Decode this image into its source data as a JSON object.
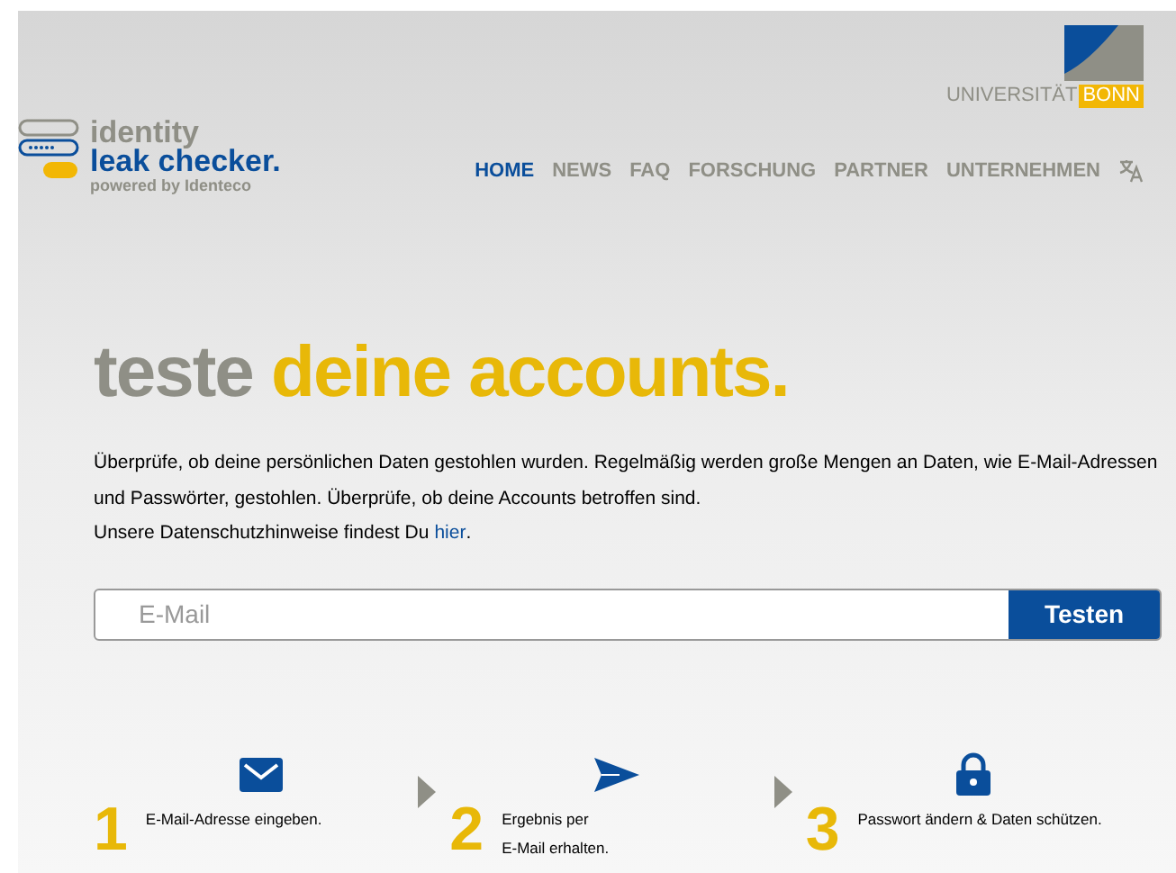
{
  "university_logo": {
    "name": "UNIVERSITÄT",
    "highlight": "BONN"
  },
  "brand": {
    "line_1": "identity",
    "line_2": "leak checker.",
    "tagline": "powered by Identeco"
  },
  "nav": [
    {
      "label": "HOME",
      "selected": true
    },
    {
      "label": "NEWS",
      "selected": false
    },
    {
      "label": "FAQ",
      "selected": false
    },
    {
      "label": "FORSCHUNG",
      "selected": false
    },
    {
      "label": "PARTNER",
      "selected": false
    },
    {
      "label": "UNTERNEHMEN",
      "selected": false
    }
  ],
  "headline": {
    "part_1": "teste",
    "part_2": "deine accounts."
  },
  "intro": "Überprüfe, ob deine persönlichen Daten gestohlen wurden. Regelmäßig werden große Mengen an Daten, wie E-Mail-Adressen und Passwörter, gestohlen. Überprüfe, ob deine Accounts betroffen sind.",
  "privacy": {
    "text": "Unsere Datenschutzhinweise findest Du",
    "link": "hier",
    "end": "."
  },
  "search": {
    "placeholder": "E-Mail",
    "button": "Testen"
  },
  "steps": [
    {
      "number": "1",
      "text": "E-Mail-Adresse eingeben.",
      "kind": "mail"
    },
    {
      "number": "2",
      "text": "Ergebnis per\nE-Mail erhalten.",
      "kind": "send"
    },
    {
      "number": "3",
      "text": "Passwort ändern & Daten schützen.",
      "kind": "lock"
    }
  ]
}
